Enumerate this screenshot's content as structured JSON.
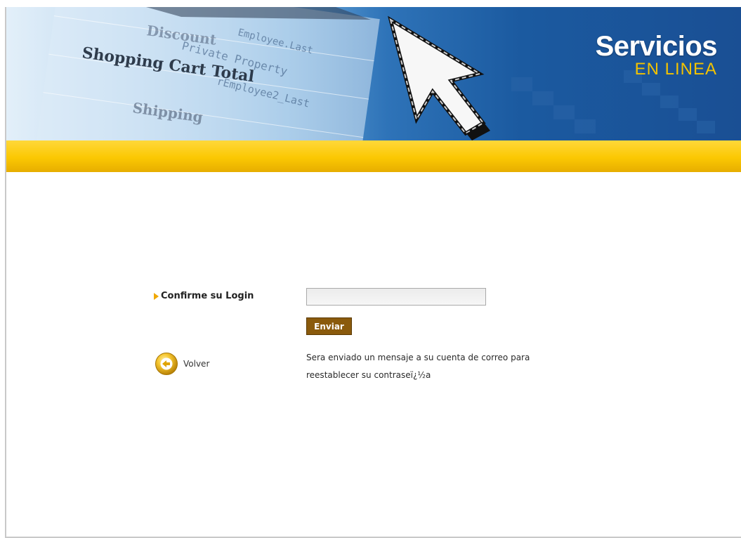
{
  "header": {
    "brand_title": "Servicios",
    "brand_subtitle": "EN LINEA",
    "banner_background_text": [
      "Shopping Cart Total",
      "Shipping",
      "Discount",
      "Private Property"
    ]
  },
  "form": {
    "login_label": "Confirme su Login",
    "login_value": "",
    "send_button_label": "Enviar",
    "back_label": "Volver",
    "message_line1": "Sera enviado un mensaje a su cuenta de correo para",
    "message_line2": "reestablecer su contraseï¿½a"
  },
  "icons": {
    "label_marker": "triangle-arrow-icon",
    "back": "back-arrow-circle-icon",
    "banner_cursor": "mouse-cursor-icon"
  },
  "colors": {
    "accent_yellow": "#fbc802",
    "brand_blue": "#1b5aa0",
    "button_brown": "#8a5a0c",
    "subtitle_gold": "#f2c200"
  }
}
